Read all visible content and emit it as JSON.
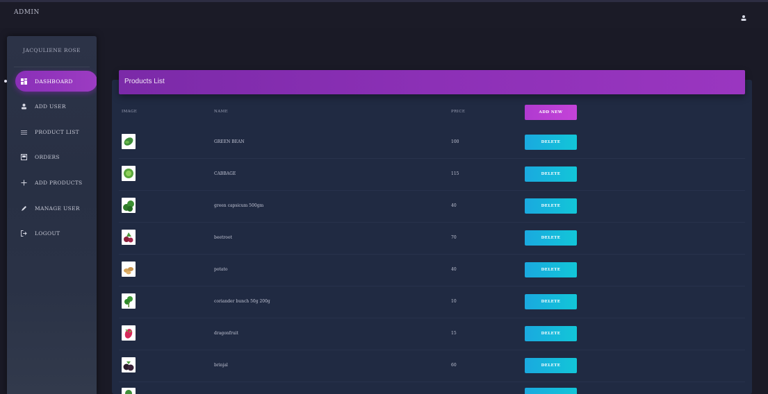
{
  "brand": "ADMIN",
  "sidebar": {
    "user_name": "JACQULIENE ROSE",
    "items": [
      {
        "label": "DASHBOARD",
        "icon": "dashboard-icon",
        "active": true
      },
      {
        "label": "ADD USER",
        "icon": "user-icon",
        "active": false
      },
      {
        "label": "PRODUCT LIST",
        "icon": "list-icon",
        "active": false
      },
      {
        "label": "ORDERS",
        "icon": "orders-icon",
        "active": false
      },
      {
        "label": "ADD PRODUCTS",
        "icon": "plus-icon",
        "active": false
      },
      {
        "label": "MANAGE USER",
        "icon": "pencil-icon",
        "active": false
      },
      {
        "label": "LOGOUT",
        "icon": "logout-icon",
        "active": false
      }
    ]
  },
  "products": {
    "title": "Products List",
    "columns": {
      "image": "IMAGE",
      "name": "NAME",
      "price": "PRICE"
    },
    "add_label": "ADD NEW",
    "delete_label": "DELETE",
    "rows": [
      {
        "name": "GREEN BEAN",
        "price": "100",
        "thumb": "green-bean-thumbnail"
      },
      {
        "name": "CABBAGE",
        "price": "115",
        "thumb": "cabbage-thumbnail"
      },
      {
        "name": "green capsicum 500gm",
        "price": "40",
        "thumb": "capsicum-thumbnail"
      },
      {
        "name": "beetroot",
        "price": "70",
        "thumb": "beetroot-thumbnail"
      },
      {
        "name": "potato",
        "price": "40",
        "thumb": "potato-thumbnail"
      },
      {
        "name": "coriander bunch 50g 200g",
        "price": "10",
        "thumb": "coriander-thumbnail"
      },
      {
        "name": "dragonfruit",
        "price": "15",
        "thumb": "dragonfruit-thumbnail"
      },
      {
        "name": "brinjal",
        "price": "60",
        "thumb": "brinjal-thumbnail"
      },
      {
        "name": "",
        "price": "",
        "thumb": "vegetable-thumbnail"
      }
    ]
  },
  "colors": {
    "accent_purple": "#8c30b6",
    "delete_cyan": "#12c6d8",
    "background": "#1a1a26",
    "card": "#202a42"
  }
}
